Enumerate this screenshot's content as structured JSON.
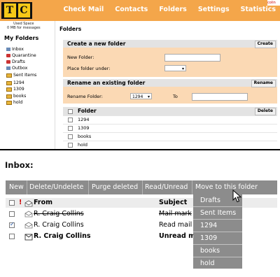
{
  "top": {
    "logo_letters": [
      "T",
      "C"
    ],
    "used_space": "Used Space",
    "used_space_detail": "0 MB for messages",
    "user_box": "colin",
    "nav": [
      "Check Mail",
      "Contacts",
      "Folders",
      "Settings",
      "Statistics"
    ],
    "sidebar_title": "My Folders",
    "sidebar_items": [
      "Inbox",
      "Quarantine",
      "Drafts",
      "Outbox",
      "Sent Items",
      "1294",
      "1309",
      "books",
      "hold"
    ],
    "page_title": "Folders",
    "create": {
      "title": "Create a new folder",
      "button": "Create",
      "new_folder_label": "New Folder:",
      "place_under_label": "Place folder under:"
    },
    "rename": {
      "title": "Rename an existing folder",
      "button": "Rename",
      "label": "Rename Folder:",
      "selected": "1294",
      "to_label": "To"
    },
    "folder_table": {
      "header": "Folder",
      "button": "Delete",
      "rows": [
        "1294",
        "1309",
        "books",
        "hold"
      ]
    }
  },
  "inbox": {
    "title": "Inbox:",
    "toolbar": [
      "New",
      "Delete/Undelete",
      "Purge deleted",
      "Read/Unread",
      "Move to this folder"
    ],
    "header": {
      "flag": "!",
      "from": "From",
      "subject": "Subject"
    },
    "rows": [
      {
        "from": "R. Craig Collins",
        "subject": "Mail mark",
        "checked": false,
        "deleted": true,
        "unread": false
      },
      {
        "from": "R. Craig Collins",
        "subject": "Read mail",
        "checked": true,
        "deleted": false,
        "unread": false
      },
      {
        "from": "R. Craig Collins",
        "subject": "Unread m",
        "checked": false,
        "deleted": false,
        "unread": true
      }
    ],
    "move_menu": [
      "Drafts",
      "Sent Items",
      "1294",
      "1309",
      "books",
      "hold"
    ]
  },
  "colors": {
    "orange_bar": "#f4a64a",
    "panel_bg": "#fbd9b4",
    "toolbar_gray": "#8c8c8c"
  }
}
